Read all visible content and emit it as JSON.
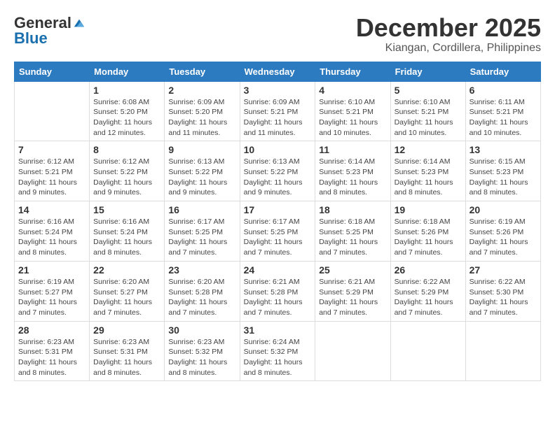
{
  "logo": {
    "general": "General",
    "blue": "Blue"
  },
  "title": "December 2025",
  "location": "Kiangan, Cordillera, Philippines",
  "headers": [
    "Sunday",
    "Monday",
    "Tuesday",
    "Wednesday",
    "Thursday",
    "Friday",
    "Saturday"
  ],
  "weeks": [
    [
      {
        "day": "",
        "sunrise": "",
        "sunset": "",
        "daylight": ""
      },
      {
        "day": "1",
        "sunrise": "Sunrise: 6:08 AM",
        "sunset": "Sunset: 5:20 PM",
        "daylight": "Daylight: 11 hours and 12 minutes."
      },
      {
        "day": "2",
        "sunrise": "Sunrise: 6:09 AM",
        "sunset": "Sunset: 5:20 PM",
        "daylight": "Daylight: 11 hours and 11 minutes."
      },
      {
        "day": "3",
        "sunrise": "Sunrise: 6:09 AM",
        "sunset": "Sunset: 5:21 PM",
        "daylight": "Daylight: 11 hours and 11 minutes."
      },
      {
        "day": "4",
        "sunrise": "Sunrise: 6:10 AM",
        "sunset": "Sunset: 5:21 PM",
        "daylight": "Daylight: 11 hours and 10 minutes."
      },
      {
        "day": "5",
        "sunrise": "Sunrise: 6:10 AM",
        "sunset": "Sunset: 5:21 PM",
        "daylight": "Daylight: 11 hours and 10 minutes."
      },
      {
        "day": "6",
        "sunrise": "Sunrise: 6:11 AM",
        "sunset": "Sunset: 5:21 PM",
        "daylight": "Daylight: 11 hours and 10 minutes."
      }
    ],
    [
      {
        "day": "7",
        "sunrise": "Sunrise: 6:12 AM",
        "sunset": "Sunset: 5:21 PM",
        "daylight": "Daylight: 11 hours and 9 minutes."
      },
      {
        "day": "8",
        "sunrise": "Sunrise: 6:12 AM",
        "sunset": "Sunset: 5:22 PM",
        "daylight": "Daylight: 11 hours and 9 minutes."
      },
      {
        "day": "9",
        "sunrise": "Sunrise: 6:13 AM",
        "sunset": "Sunset: 5:22 PM",
        "daylight": "Daylight: 11 hours and 9 minutes."
      },
      {
        "day": "10",
        "sunrise": "Sunrise: 6:13 AM",
        "sunset": "Sunset: 5:22 PM",
        "daylight": "Daylight: 11 hours and 9 minutes."
      },
      {
        "day": "11",
        "sunrise": "Sunrise: 6:14 AM",
        "sunset": "Sunset: 5:23 PM",
        "daylight": "Daylight: 11 hours and 8 minutes."
      },
      {
        "day": "12",
        "sunrise": "Sunrise: 6:14 AM",
        "sunset": "Sunset: 5:23 PM",
        "daylight": "Daylight: 11 hours and 8 minutes."
      },
      {
        "day": "13",
        "sunrise": "Sunrise: 6:15 AM",
        "sunset": "Sunset: 5:23 PM",
        "daylight": "Daylight: 11 hours and 8 minutes."
      }
    ],
    [
      {
        "day": "14",
        "sunrise": "Sunrise: 6:16 AM",
        "sunset": "Sunset: 5:24 PM",
        "daylight": "Daylight: 11 hours and 8 minutes."
      },
      {
        "day": "15",
        "sunrise": "Sunrise: 6:16 AM",
        "sunset": "Sunset: 5:24 PM",
        "daylight": "Daylight: 11 hours and 8 minutes."
      },
      {
        "day": "16",
        "sunrise": "Sunrise: 6:17 AM",
        "sunset": "Sunset: 5:25 PM",
        "daylight": "Daylight: 11 hours and 7 minutes."
      },
      {
        "day": "17",
        "sunrise": "Sunrise: 6:17 AM",
        "sunset": "Sunset: 5:25 PM",
        "daylight": "Daylight: 11 hours and 7 minutes."
      },
      {
        "day": "18",
        "sunrise": "Sunrise: 6:18 AM",
        "sunset": "Sunset: 5:25 PM",
        "daylight": "Daylight: 11 hours and 7 minutes."
      },
      {
        "day": "19",
        "sunrise": "Sunrise: 6:18 AM",
        "sunset": "Sunset: 5:26 PM",
        "daylight": "Daylight: 11 hours and 7 minutes."
      },
      {
        "day": "20",
        "sunrise": "Sunrise: 6:19 AM",
        "sunset": "Sunset: 5:26 PM",
        "daylight": "Daylight: 11 hours and 7 minutes."
      }
    ],
    [
      {
        "day": "21",
        "sunrise": "Sunrise: 6:19 AM",
        "sunset": "Sunset: 5:27 PM",
        "daylight": "Daylight: 11 hours and 7 minutes."
      },
      {
        "day": "22",
        "sunrise": "Sunrise: 6:20 AM",
        "sunset": "Sunset: 5:27 PM",
        "daylight": "Daylight: 11 hours and 7 minutes."
      },
      {
        "day": "23",
        "sunrise": "Sunrise: 6:20 AM",
        "sunset": "Sunset: 5:28 PM",
        "daylight": "Daylight: 11 hours and 7 minutes."
      },
      {
        "day": "24",
        "sunrise": "Sunrise: 6:21 AM",
        "sunset": "Sunset: 5:28 PM",
        "daylight": "Daylight: 11 hours and 7 minutes."
      },
      {
        "day": "25",
        "sunrise": "Sunrise: 6:21 AM",
        "sunset": "Sunset: 5:29 PM",
        "daylight": "Daylight: 11 hours and 7 minutes."
      },
      {
        "day": "26",
        "sunrise": "Sunrise: 6:22 AM",
        "sunset": "Sunset: 5:29 PM",
        "daylight": "Daylight: 11 hours and 7 minutes."
      },
      {
        "day": "27",
        "sunrise": "Sunrise: 6:22 AM",
        "sunset": "Sunset: 5:30 PM",
        "daylight": "Daylight: 11 hours and 7 minutes."
      }
    ],
    [
      {
        "day": "28",
        "sunrise": "Sunrise: 6:23 AM",
        "sunset": "Sunset: 5:31 PM",
        "daylight": "Daylight: 11 hours and 8 minutes."
      },
      {
        "day": "29",
        "sunrise": "Sunrise: 6:23 AM",
        "sunset": "Sunset: 5:31 PM",
        "daylight": "Daylight: 11 hours and 8 minutes."
      },
      {
        "day": "30",
        "sunrise": "Sunrise: 6:23 AM",
        "sunset": "Sunset: 5:32 PM",
        "daylight": "Daylight: 11 hours and 8 minutes."
      },
      {
        "day": "31",
        "sunrise": "Sunrise: 6:24 AM",
        "sunset": "Sunset: 5:32 PM",
        "daylight": "Daylight: 11 hours and 8 minutes."
      },
      {
        "day": "",
        "sunrise": "",
        "sunset": "",
        "daylight": ""
      },
      {
        "day": "",
        "sunrise": "",
        "sunset": "",
        "daylight": ""
      },
      {
        "day": "",
        "sunrise": "",
        "sunset": "",
        "daylight": ""
      }
    ]
  ]
}
